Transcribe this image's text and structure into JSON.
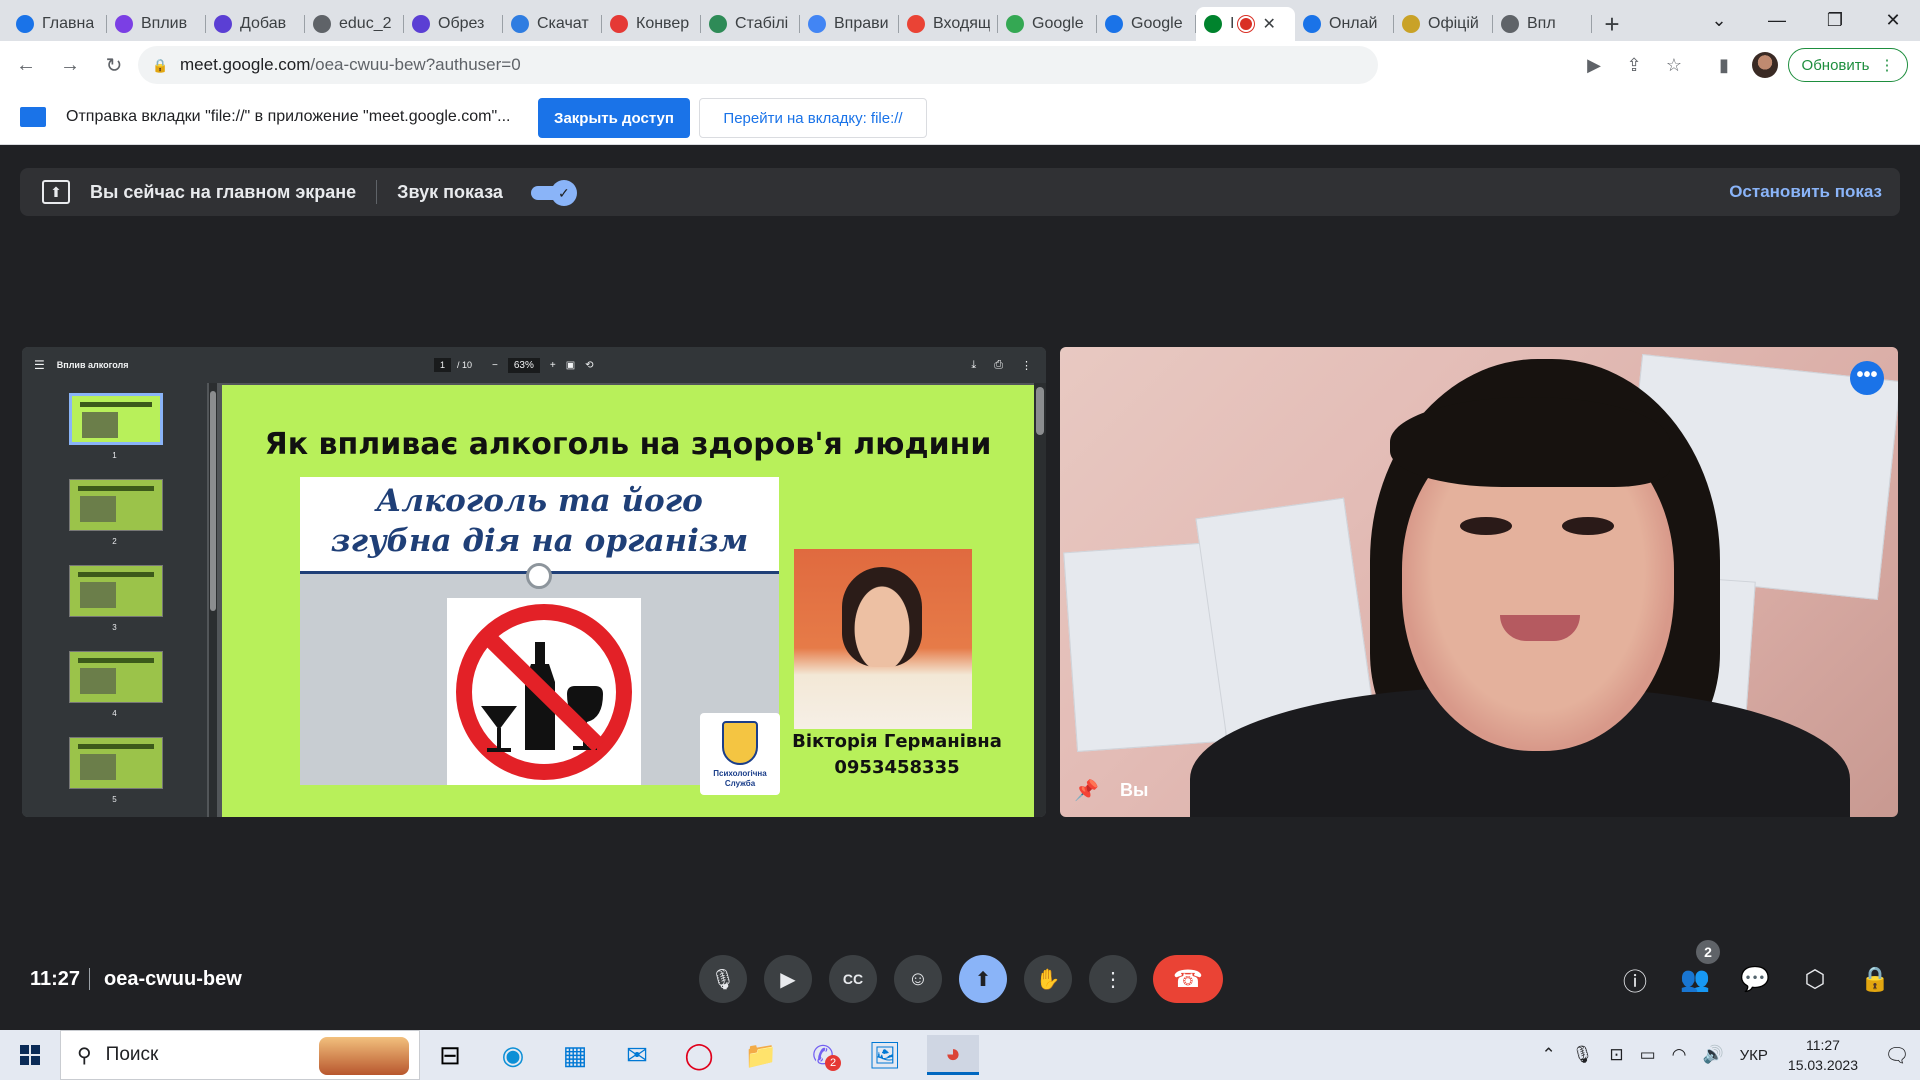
{
  "tabs": [
    {
      "label": "Главна",
      "color": "#1a73e8"
    },
    {
      "label": "Вплив",
      "color": "#7b3fe4"
    },
    {
      "label": "Добав",
      "color": "#5b3fd4"
    },
    {
      "label": "educ_2",
      "color": "#5f6368"
    },
    {
      "label": "Обрез",
      "color": "#5b3fd4"
    },
    {
      "label": "Скачат",
      "color": "#2f7de1"
    },
    {
      "label": "Конвер",
      "color": "#e53935"
    },
    {
      "label": "Стабілі",
      "color": "#2e8b57"
    },
    {
      "label": "Вправи",
      "color": "#4285f4"
    },
    {
      "label": "Входящ",
      "color": "#ea4335"
    },
    {
      "label": "Google",
      "color": "#34a853"
    },
    {
      "label": "Google",
      "color": "#1a73e8"
    },
    {
      "label": "I",
      "color": "#00832d",
      "active": true
    },
    {
      "label": "Онлай",
      "color": "#1a73e8"
    },
    {
      "label": "Офіцій",
      "color": "#c9a227"
    },
    {
      "label": "Впл",
      "color": "#5f6368"
    }
  ],
  "address": {
    "host": "meet.google.com",
    "path": "/oea-cwuu-bew?authuser=0"
  },
  "update_label": "Обновить",
  "infobar": {
    "message": "Отправка вкладки \"file://\" в приложение \"meet.google.com\"...",
    "close_access": "Закрыть доступ",
    "go_to_tab": "Перейти на вкладку: file://"
  },
  "sharebar": {
    "status": "Вы сейчас на главном экране",
    "sound": "Звук показа",
    "sound_on": true,
    "stop": "Остановить показ"
  },
  "pdf": {
    "title": "Вплив алкоголя",
    "page_current": "1",
    "page_total": "/ 10",
    "zoom": "63%",
    "thumbnails": [
      "1",
      "2",
      "3",
      "4",
      "5"
    ]
  },
  "slide": {
    "heading": "Як впливає алкоголь на здоров'я людини",
    "banner_line1": "Алкоголь та його",
    "banner_line2": "згубна дія на організм",
    "logo_text": "Психологічна Служба",
    "author_name": "Вікторія Германівна",
    "author_phone": "0953458335"
  },
  "video": {
    "label": "Вы"
  },
  "meeting": {
    "time": "11:27",
    "code": "oea-cwuu-bew",
    "participants_count": "2"
  },
  "taskbar": {
    "search_placeholder": "Поиск",
    "lang": "УКР",
    "time": "11:27",
    "date": "15.03.2023",
    "viber_badge": "2"
  }
}
